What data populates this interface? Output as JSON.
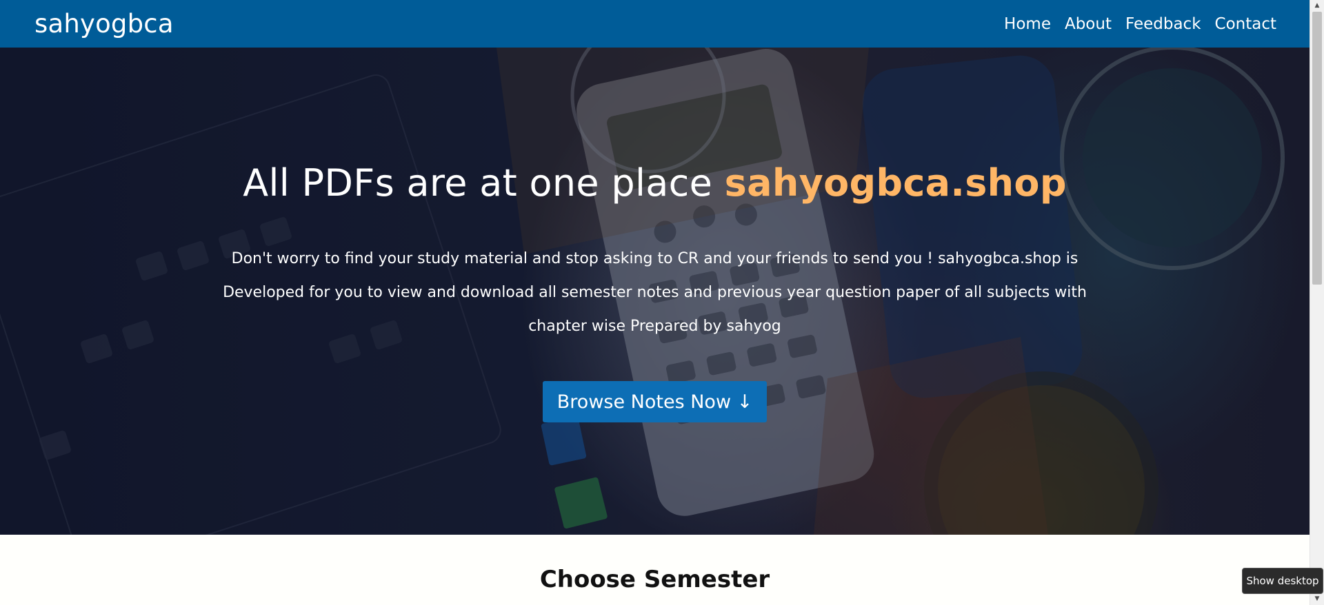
{
  "navbar": {
    "brand": "sahyogbca",
    "links": [
      "Home",
      "About",
      "Feedback",
      "Contact"
    ]
  },
  "hero": {
    "title_prefix": "All PDFs are at one place ",
    "title_accent": "sahyogbca.shop",
    "description": "Don't worry to find your study material and stop asking to CR and your friends to send you ! sahyogbca.shop is Developed for you to view and download all semester notes and previous year question paper of all subjects with chapter wise Prepared by sahyog",
    "button_label": "Browse Notes Now ↓"
  },
  "section": {
    "title": "Choose Semester"
  },
  "tooltip": {
    "text": "Show desktop"
  },
  "colors": {
    "navbar_bg": "#005c98",
    "accent_text": "#ffb666",
    "button_bg": "#0d6eb5"
  },
  "icons": {
    "scroll_up": "scroll-up-arrow-icon",
    "scroll_down": "scroll-down-arrow-icon"
  }
}
